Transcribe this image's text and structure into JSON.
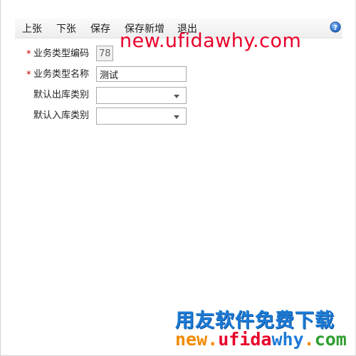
{
  "toolbar": {
    "prev_label": "上张",
    "next_label": "下张",
    "save_label": "保存",
    "save_new_label": "保存新增",
    "exit_label": "退出"
  },
  "form": {
    "required_mark": "*",
    "code": {
      "label": "业务类型编码",
      "value": "78"
    },
    "name": {
      "label": "业务类型名称",
      "value": "测试"
    },
    "out_category": {
      "label": "默认出库类别",
      "value": ""
    },
    "in_category": {
      "label": "默认入库类别",
      "value": ""
    }
  },
  "watermark": {
    "top_url": "new.ufidawhy.com",
    "brand": "用友软件免费下载",
    "bottom_new": "new",
    "bottom_dot1": ".",
    "bottom_ufida": "ufida",
    "bottom_why": "why",
    "bottom_dot2": ".",
    "bottom_com": "com"
  },
  "colors": {
    "required_star": "#c00000",
    "help_icon": "#2a6fc9",
    "watermark_red": "#e8002a",
    "watermark_blue": "#1c7bd6",
    "watermark_orange": "#f28a00",
    "watermark_green": "#2f9e2f"
  },
  "icons": {
    "help": "help-icon",
    "dropdown": "chevron-down-icon"
  }
}
